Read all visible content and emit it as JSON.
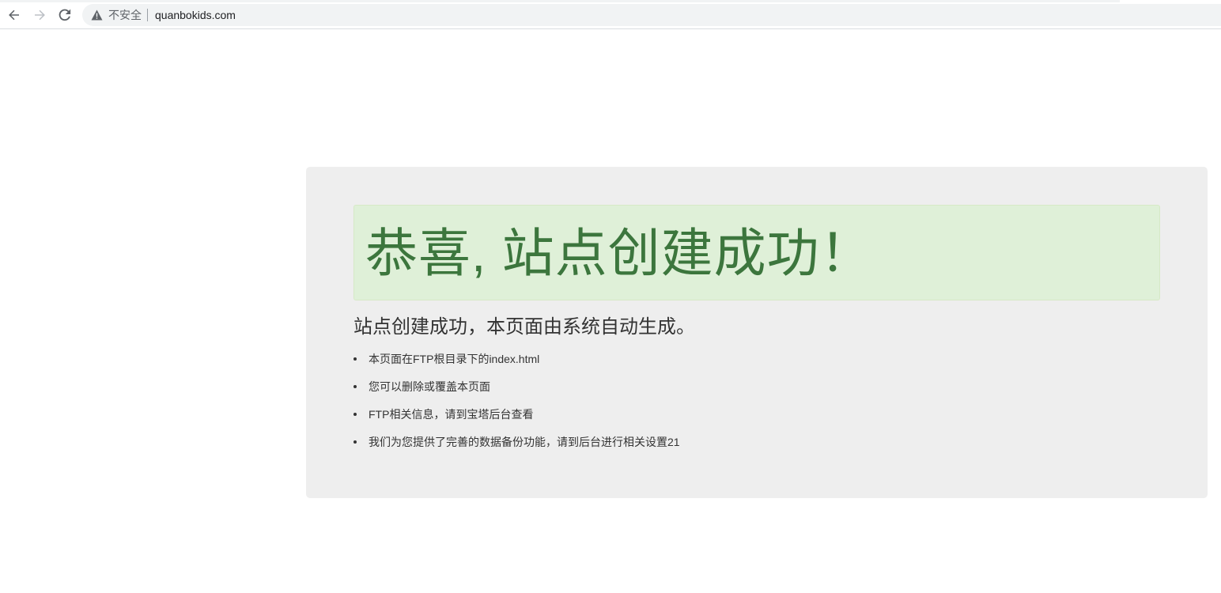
{
  "browser": {
    "security_label": "不安全",
    "url": "quanbokids.com",
    "icons": {
      "back": "arrow-left-icon",
      "forward": "arrow-right-icon",
      "reload": "reload-icon",
      "security": "warning-triangle-icon"
    }
  },
  "page": {
    "heading": "恭喜, 站点创建成功！",
    "subtitle": "站点创建成功，本页面由系统自动生成。",
    "items": [
      "本页面在FTP根目录下的index.html",
      "您可以删除或覆盖本页面",
      "FTP相关信息，请到宝塔后台查看",
      "我们为您提供了完善的数据备份功能，请到后台进行相关设置21"
    ]
  },
  "colors": {
    "alert_bg": "#dff0d8",
    "alert_text": "#3c763d",
    "panel_bg": "#eeeeee",
    "body_text": "#333333"
  }
}
